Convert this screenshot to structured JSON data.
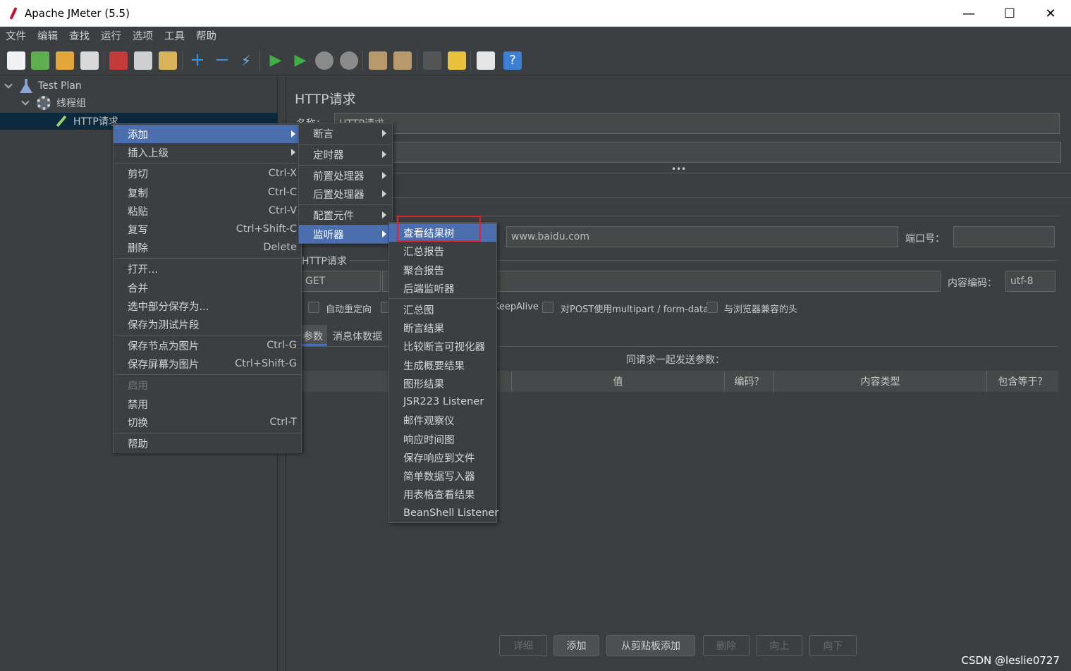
{
  "window": {
    "title": "Apache JMeter (5.5)",
    "minimize": "—",
    "maximize": "☐",
    "close": "✕"
  },
  "menubar": [
    "文件",
    "编辑",
    "查找",
    "运行",
    "选项",
    "工具",
    "帮助"
  ],
  "tree": {
    "test_plan": "Test Plan",
    "thread_group": "线程组",
    "http_request": "HTTP请求"
  },
  "main": {
    "panel_title": "HTTP请求",
    "name_label": "名称：",
    "name_value": "HTTP请求",
    "server_value": "www.baidu.com",
    "port_label": "端口号：",
    "port_value": "",
    "http_section_label": "HTTP请求",
    "method_value": "GET",
    "encoding_label": "内容编码：",
    "encoding_value": "utf-8",
    "checkbox_redirect": "自动重定向",
    "checkbox_keepalive": "KeepAlive",
    "checkbox_multipart": "对POST使用multipart / form-data",
    "checkbox_browser_headers": "与浏览器兼容的头",
    "tab_params": "参数",
    "tab_body": "消息体数据",
    "params_caption": "同请求一起发送参数：",
    "columns": [
      "值",
      "编码？",
      "内容类型",
      "包含等于？"
    ],
    "buttons": {
      "detail": "详细",
      "add": "添加",
      "add_clipboard": "从剪贴板添加",
      "delete": "删除",
      "up": "向上",
      "down": "向下"
    }
  },
  "context_menu": {
    "items": [
      {
        "label": "添加",
        "shortcut": ""
      },
      {
        "label": "插入上级",
        "shortcut": ""
      },
      {
        "label": "剪切",
        "shortcut": "Ctrl-X"
      },
      {
        "label": "复制",
        "shortcut": "Ctrl-C"
      },
      {
        "label": "粘贴",
        "shortcut": "Ctrl-V"
      },
      {
        "label": "复写",
        "shortcut": "Ctrl+Shift-C"
      },
      {
        "label": "删除",
        "shortcut": "Delete"
      },
      {
        "label": "打开...",
        "shortcut": ""
      },
      {
        "label": "合并",
        "shortcut": ""
      },
      {
        "label": "选中部分保存为...",
        "shortcut": ""
      },
      {
        "label": "保存为测试片段",
        "shortcut": ""
      },
      {
        "label": "保存节点为图片",
        "shortcut": "Ctrl-G"
      },
      {
        "label": "保存屏幕为图片",
        "shortcut": "Ctrl+Shift-G"
      },
      {
        "label": "启用",
        "shortcut": ""
      },
      {
        "label": "禁用",
        "shortcut": ""
      },
      {
        "label": "切换",
        "shortcut": "Ctrl-T"
      },
      {
        "label": "帮助",
        "shortcut": ""
      }
    ]
  },
  "add_submenu": [
    "断言",
    "定时器",
    "前置处理器",
    "后置处理器",
    "配置元件",
    "监听器"
  ],
  "listener_submenu": [
    "查看结果树",
    "汇总报告",
    "聚合报告",
    "后端监听器",
    "汇总图",
    "断言结果",
    "比较断言可视化器",
    "生成概要结果",
    "图形结果",
    "JSR223 Listener",
    "邮件观察仪",
    "响应时间图",
    "保存响应到文件",
    "简单数据写入器",
    "用表格查看结果",
    "BeanShell Listener"
  ],
  "watermark": "CSDN @leslie0727",
  "colors": {
    "background": "#3c3f41",
    "highlight": "#4b6eaf",
    "annotation_box": "#e0242a"
  }
}
